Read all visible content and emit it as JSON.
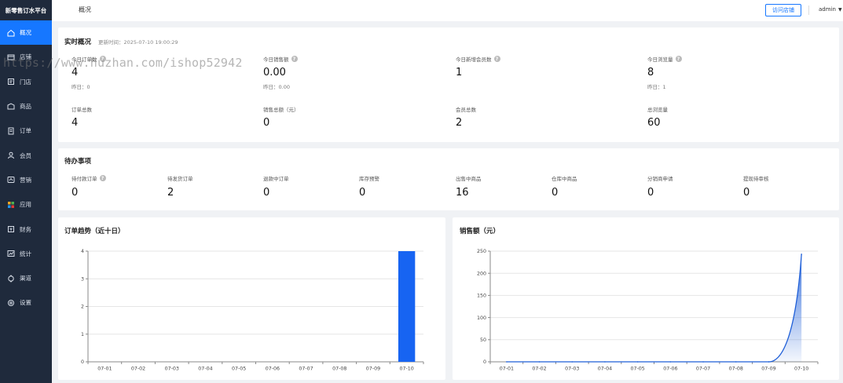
{
  "sidebar": {
    "brand": "新零售订水平台",
    "items": [
      {
        "label": "概况",
        "icon": "home-icon",
        "active": true
      },
      {
        "label": "店铺",
        "icon": "store-icon"
      },
      {
        "label": "门店",
        "icon": "shop-icon"
      },
      {
        "label": "商品",
        "icon": "product-icon"
      },
      {
        "label": "订单",
        "icon": "order-icon"
      },
      {
        "label": "会员",
        "icon": "user-icon"
      },
      {
        "label": "营销",
        "icon": "marketing-icon"
      },
      {
        "label": "应用",
        "icon": "apps-icon"
      },
      {
        "label": "财务",
        "icon": "finance-icon"
      },
      {
        "label": "统计",
        "icon": "chart-icon"
      },
      {
        "label": "渠道",
        "icon": "channel-icon"
      },
      {
        "label": "设置",
        "icon": "settings-icon"
      }
    ]
  },
  "header": {
    "title": "概况",
    "visit_button": "访问店铺",
    "user": "admin"
  },
  "watermark": "https://www.huzhan.com/ishop52942",
  "realtime": {
    "title": "实时概况",
    "update_time": "更新时间：2025-07-10 19:00:29",
    "stats": [
      {
        "label": "今日订单数",
        "value": "4",
        "yesterday": "昨日：0",
        "help": true
      },
      {
        "label": "今日销售额",
        "value": "0.00",
        "yesterday": "昨日：0.00",
        "help": true
      },
      {
        "label": "今日新增会员数",
        "value": "1",
        "yesterday": "",
        "help": true
      },
      {
        "label": "今日浏览量",
        "value": "8",
        "yesterday": "昨日：1",
        "help": true
      }
    ],
    "totals": [
      {
        "label": "订单总数",
        "value": "4"
      },
      {
        "label": "销售总额（元）",
        "value": "0"
      },
      {
        "label": "会员总数",
        "value": "2"
      },
      {
        "label": "总浏览量",
        "value": "60"
      }
    ]
  },
  "todo": {
    "title": "待办事项",
    "items": [
      {
        "label": "待付款订单",
        "value": "0",
        "help": true
      },
      {
        "label": "待发货订单",
        "value": "2"
      },
      {
        "label": "退款中订单",
        "value": "0"
      },
      {
        "label": "库存预警",
        "value": "0"
      },
      {
        "label": "出售中商品",
        "value": "16"
      },
      {
        "label": "仓库中商品",
        "value": "0"
      },
      {
        "label": "分销商申请",
        "value": "0"
      },
      {
        "label": "提现待审核",
        "value": "0"
      }
    ]
  },
  "chart_data": [
    {
      "type": "bar",
      "title": "订单趋势（近十日）",
      "categories": [
        "07-01",
        "07-02",
        "07-03",
        "07-04",
        "07-05",
        "07-06",
        "07-07",
        "07-08",
        "07-09",
        "07-10"
      ],
      "values": [
        0,
        0,
        0,
        0,
        0,
        0,
        0,
        0,
        0,
        4
      ],
      "ylim": [
        0,
        4
      ],
      "yticks": [
        0,
        1,
        2,
        3,
        4
      ],
      "color": "#1764f2"
    },
    {
      "type": "area",
      "title": "销售额（元）",
      "categories": [
        "07-01",
        "07-02",
        "07-03",
        "07-04",
        "07-05",
        "07-06",
        "07-07",
        "07-08",
        "07-09",
        "07-10"
      ],
      "values": [
        0,
        0,
        0,
        0,
        0,
        0,
        0,
        0,
        0,
        243
      ],
      "ylim": [
        0,
        250
      ],
      "yticks": [
        0,
        50,
        100,
        150,
        200,
        250
      ],
      "color": "#1f5fd8"
    }
  ]
}
